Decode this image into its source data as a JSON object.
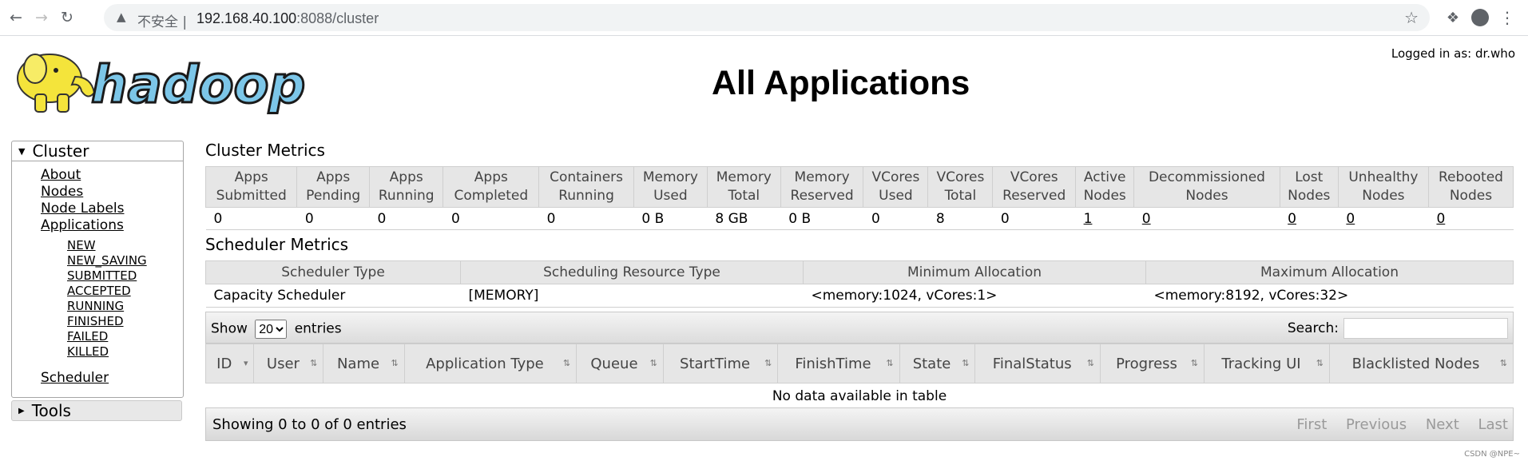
{
  "browser": {
    "insecure_label": "不安全 |",
    "url_host": "192.168.40.100",
    "url_rest": ":8088/cluster"
  },
  "header": {
    "logged_in": "Logged in as: dr.who",
    "title": "All Applications",
    "logo_text": "hadoop"
  },
  "sidebar": {
    "cluster_label": "Cluster",
    "links": [
      "About",
      "Nodes",
      "Node Labels",
      "Applications"
    ],
    "app_states": [
      "NEW",
      "NEW_SAVING",
      "SUBMITTED",
      "ACCEPTED",
      "RUNNING",
      "FINISHED",
      "FAILED",
      "KILLED"
    ],
    "scheduler": "Scheduler",
    "tools_label": "Tools"
  },
  "cluster_metrics": {
    "title": "Cluster Metrics",
    "headers": [
      [
        "Apps",
        "Submitted"
      ],
      [
        "Apps",
        "Pending"
      ],
      [
        "Apps",
        "Running"
      ],
      [
        "Apps",
        "Completed"
      ],
      [
        "Containers",
        "Running"
      ],
      [
        "Memory",
        "Used"
      ],
      [
        "Memory",
        "Total"
      ],
      [
        "Memory",
        "Reserved"
      ],
      [
        "VCores",
        "Used"
      ],
      [
        "VCores",
        "Total"
      ],
      [
        "VCores",
        "Reserved"
      ],
      [
        "Active",
        "Nodes"
      ],
      [
        "Decommissioned",
        "Nodes"
      ],
      [
        "Lost",
        "Nodes"
      ],
      [
        "Unhealthy",
        "Nodes"
      ],
      [
        "Rebooted",
        "Nodes"
      ]
    ],
    "values": [
      "0",
      "0",
      "0",
      "0",
      "0",
      "0 B",
      "8 GB",
      "0 B",
      "0",
      "8",
      "0",
      "1",
      "0",
      "0",
      "0",
      "0"
    ]
  },
  "scheduler_metrics": {
    "title": "Scheduler Metrics",
    "headers": [
      "Scheduler Type",
      "Scheduling Resource Type",
      "Minimum Allocation",
      "Maximum Allocation"
    ],
    "values": [
      "Capacity Scheduler",
      "[MEMORY]",
      "<memory:1024, vCores:1>",
      "<memory:8192, vCores:32>"
    ]
  },
  "apps_table": {
    "show_label": "Show",
    "entries_value": "20",
    "entries_label": "entries",
    "search_label": "Search:",
    "columns": [
      "ID",
      "User",
      "Name",
      "Application Type",
      "Queue",
      "StartTime",
      "FinishTime",
      "State",
      "FinalStatus",
      "Progress",
      "Tracking UI",
      "Blacklisted Nodes"
    ],
    "empty_message": "No data available in table",
    "info": "Showing 0 to 0 of 0 entries",
    "pager": [
      "First",
      "Previous",
      "Next",
      "Last"
    ]
  },
  "watermark": "CSDN @NPE~"
}
